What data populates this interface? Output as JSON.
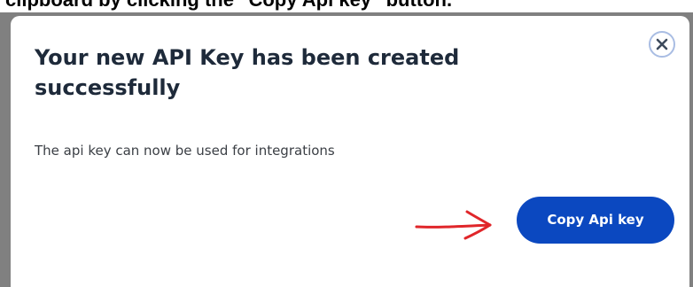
{
  "caption": {
    "text": "clipboard by clicking the \"Copy Api key\" button."
  },
  "dialog": {
    "title": "Your new API Key has been created successfully",
    "message": "The api key can now be used for integrations",
    "close_icon": "close-icon",
    "copy_button_label": "Copy Api key"
  },
  "annotation": {
    "icon": "red-arrow-icon",
    "color": "#e0262a"
  },
  "colors": {
    "backdrop": "#808080",
    "button": "#0b48c0",
    "close_ring": "#a9bde3",
    "title": "#1e2a3a"
  }
}
